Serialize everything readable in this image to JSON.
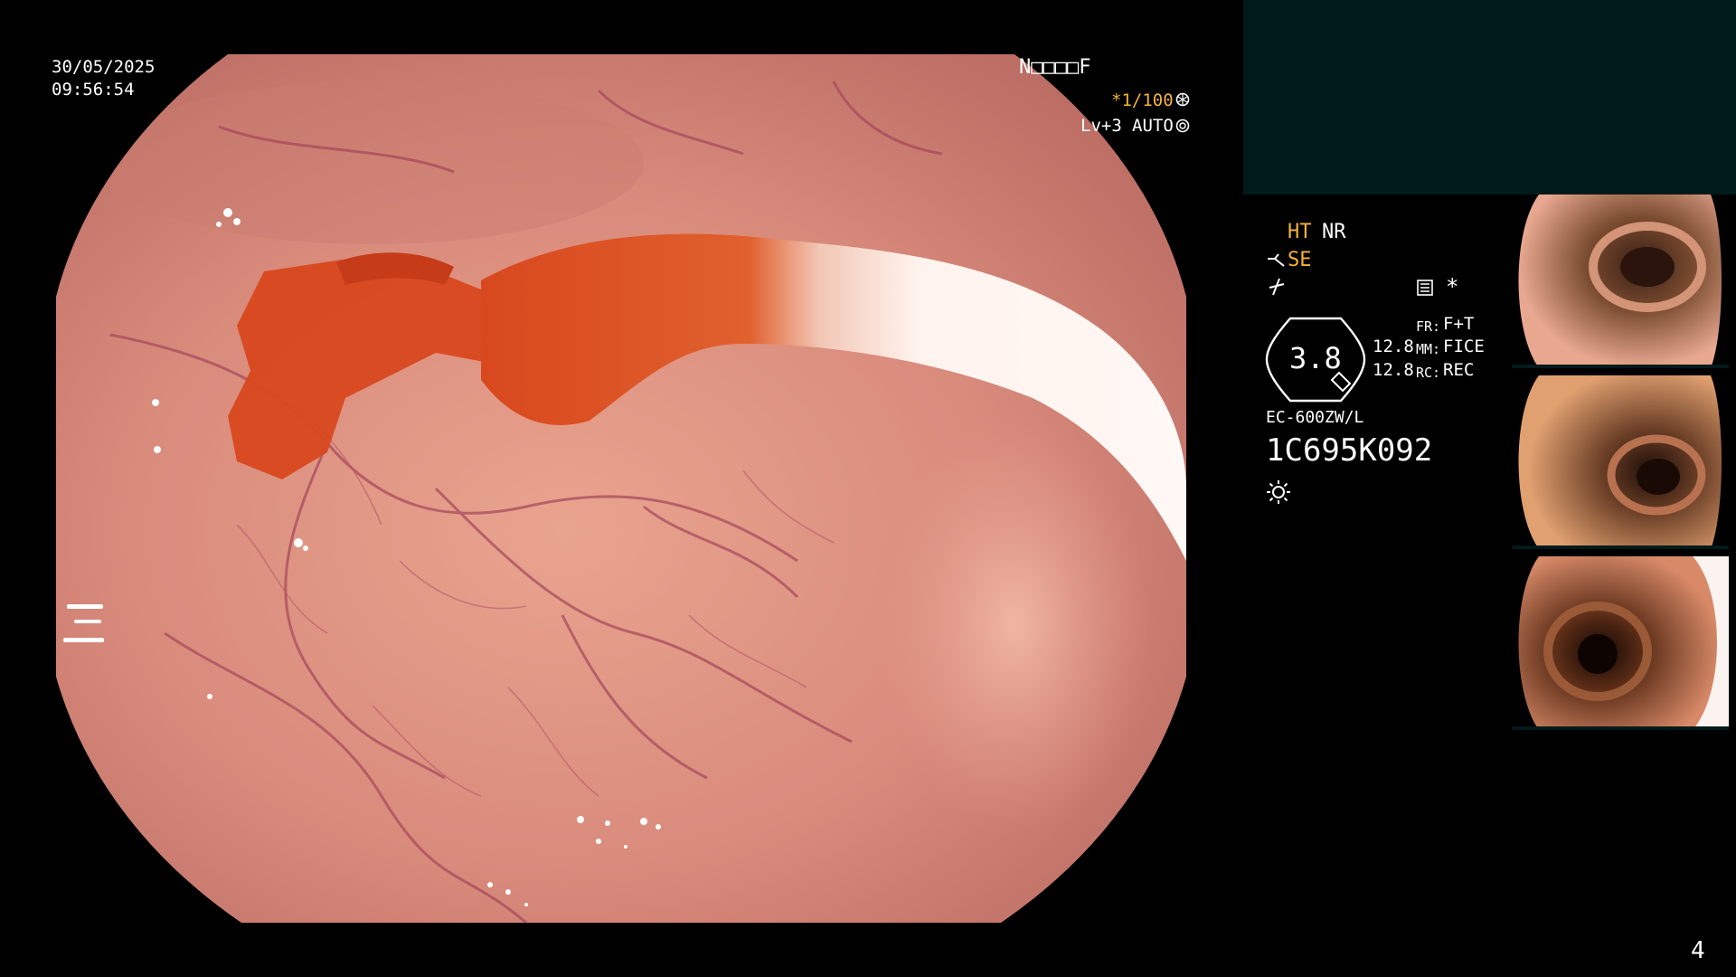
{
  "osd": {
    "date": "30/05/2025",
    "time": "09:56:54",
    "patient_code": "N□□□□F",
    "shutter": "*1/100",
    "shutter_icon": "aperture-icon",
    "level": "Lv+3",
    "iris_mode": "AUTO",
    "iris_icon": "iris-icon",
    "ht_label": "HT",
    "nr_label": "NR",
    "se_label": "SE",
    "se_icon": "scope-angle-icon",
    "flow_icon": "flow-icon",
    "record_icon": "record-icon",
    "asterisk": "*",
    "zoom_value": "3.8",
    "fr_label": "FR:",
    "fr_value": "F+T",
    "mm_value_top": "12.8",
    "mm_label": "MM:",
    "mm_value": "FICE",
    "rc_value_top": "12.8",
    "rc_label": "RC:",
    "rc_value": "REC",
    "scope_model": "EC-600ZW/L",
    "scope_serial": "1C695K092",
    "light_icon": "light-sun-icon",
    "page_number": "4"
  },
  "colors": {
    "yellow_accent": "#f5b23a",
    "panel_bg": "#001a1a",
    "mucosa": "#d98b7c",
    "blood": "#d8481e"
  }
}
